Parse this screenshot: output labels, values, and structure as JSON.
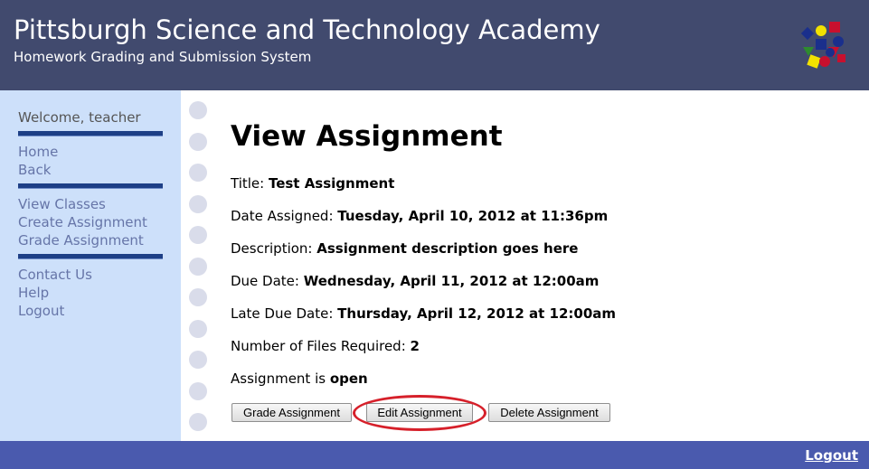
{
  "header": {
    "title": "Pittsburgh Science and Technology Academy",
    "subtitle": "Homework Grading and Submission System",
    "logo_icon": "shapes-logo-icon",
    "background": "#414a6e"
  },
  "sidebar": {
    "welcome": "Welcome, teacher",
    "groups": [
      [
        "Home",
        "Back"
      ],
      [
        "View Classes",
        "Create Assignment",
        "Grade Assignment"
      ],
      [
        "Contact Us",
        "Help",
        "Logout"
      ]
    ],
    "background": "#cde0fa",
    "link_color": "#6675a8"
  },
  "main": {
    "heading": "View Assignment",
    "fields": {
      "title": {
        "label": "Title: ",
        "value": "Test Assignment"
      },
      "date_assigned": {
        "label": "Date Assigned: ",
        "value": "Tuesday, April 10, 2012 at 11:36pm"
      },
      "description": {
        "label": "Description: ",
        "value": "Assignment description goes here"
      },
      "due_date": {
        "label": "Due Date: ",
        "value": "Wednesday, April 11, 2012 at 12:00am"
      },
      "late_due_date": {
        "label": "Late Due Date: ",
        "value": "Thursday, April 12, 2012 at 12:00am"
      },
      "files_required": {
        "label": "Number of Files Required: ",
        "value": "2"
      },
      "status": {
        "label": "Assignment is ",
        "value": "open"
      }
    },
    "buttons": {
      "grade": "Grade Assignment",
      "edit": "Edit Assignment",
      "delete": "Delete Assignment"
    },
    "highlight_color": "#d6202a"
  },
  "footer": {
    "logout": "Logout",
    "background": "#4a5aae"
  }
}
